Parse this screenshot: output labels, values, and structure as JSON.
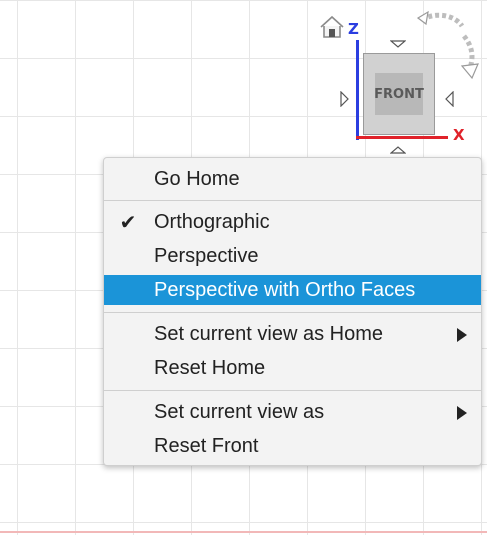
{
  "viewcube": {
    "face_label": "FRONT",
    "axis_z_label": "Z",
    "axis_x_label": "X",
    "home_icon": "home-icon",
    "orbit_icon": "rotate-icon",
    "colors": {
      "z_axis": "#2b3ee0",
      "x_axis": "#e0222a"
    }
  },
  "context_menu": {
    "go_home": "Go Home",
    "orthographic": "Orthographic",
    "perspective": "Perspective",
    "perspective_ortho_faces": "Perspective with Ortho Faces",
    "set_view_as_home": "Set current view as Home",
    "reset_home": "Reset Home",
    "set_view_as": "Set current view as",
    "reset_front": "Reset Front",
    "checked_item": "Orthographic",
    "highlighted_item": "Perspective with Ortho Faces",
    "check_glyph": "✔",
    "highlight_color": "#1b94d8"
  }
}
